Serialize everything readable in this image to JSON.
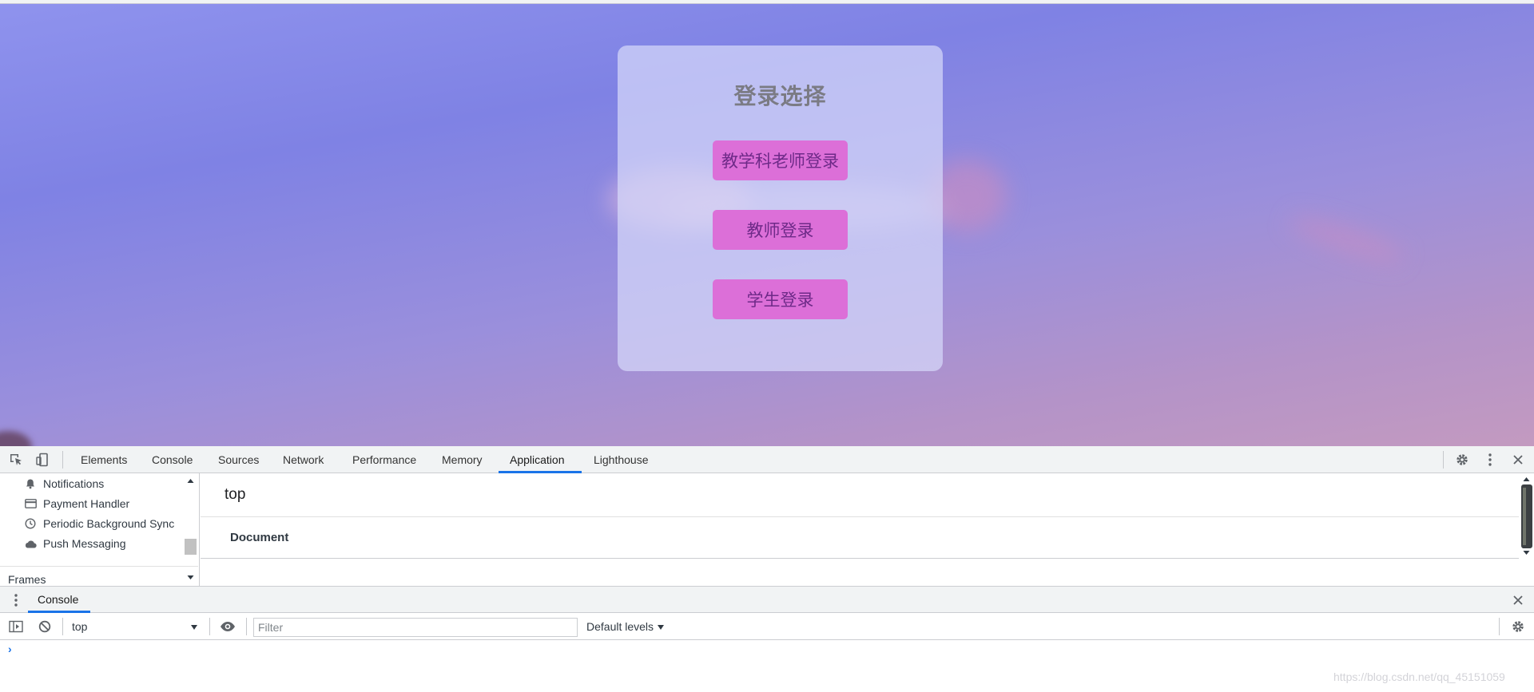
{
  "login": {
    "title": "登录选择",
    "buttons": [
      {
        "label": "教学科老师登录"
      },
      {
        "label": "教师登录"
      },
      {
        "label": "学生登录"
      }
    ],
    "button_color": "#dc6fd8",
    "button_text_color": "#6e2a88"
  },
  "devtools": {
    "toolbar": {
      "tabs": [
        "Elements",
        "Console",
        "Sources",
        "Network",
        "Performance",
        "Memory",
        "Application",
        "Lighthouse"
      ],
      "active_tab": "Application",
      "icons": [
        "inspect-icon",
        "device-toggle-icon",
        "settings-gear-icon",
        "more-vertical-icon",
        "close-icon"
      ]
    },
    "sidebar": {
      "items": [
        {
          "label": "Notifications",
          "icon": "bell-icon"
        },
        {
          "label": "Payment Handler",
          "icon": "card-icon"
        },
        {
          "label": "Periodic Background Sync",
          "icon": "clock-icon"
        },
        {
          "label": "Push Messaging",
          "icon": "cloud-icon"
        }
      ],
      "frames_header": "Frames"
    },
    "main": {
      "frame_title": "top",
      "section_label": "Document"
    },
    "drawer": {
      "tab": "Console",
      "context": "top",
      "filter_placeholder": "Filter",
      "levels": "Default levels",
      "prompt": "›"
    },
    "accent_color": "#1a73e8"
  },
  "watermark": "https://blog.csdn.net/qq_45151059"
}
